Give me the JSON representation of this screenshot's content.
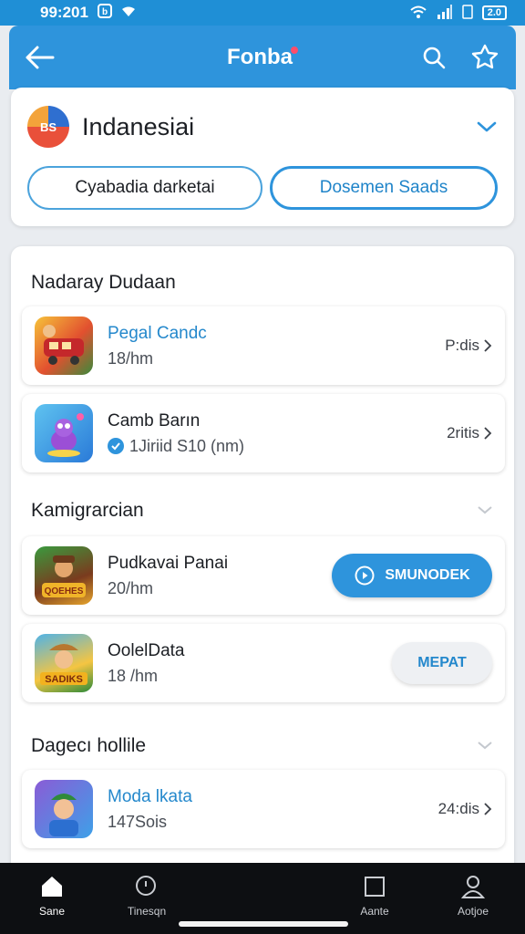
{
  "status_bar": {
    "time": "99:201",
    "battery": "2.0"
  },
  "app_bar": {
    "title": "Fonba"
  },
  "language": {
    "logo_text": "BS",
    "name": "Indanesiai"
  },
  "pills": {
    "left": "Cyabadia darketai",
    "right": "Dosemen Saads"
  },
  "sections": [
    {
      "title": "Nadaray Dudaan",
      "items": [
        {
          "name": "Pegal Candc",
          "sub": "18/hm",
          "meta": "P:dis"
        },
        {
          "name": "Camb Barın",
          "sub": "1Jiriid S10 (nm)",
          "meta": "2ritis"
        }
      ]
    },
    {
      "title": "Kamigrarcian",
      "items": [
        {
          "name": "Pudkavai Panai",
          "sub": "20/hm",
          "button": "SMUNODEK",
          "thumb_label": "QOEHES"
        },
        {
          "name": "OolelData",
          "sub": "18 /hm",
          "button": "MEPAT",
          "thumb_label": "SADIKS"
        }
      ]
    },
    {
      "title": "Dagecı hollile",
      "items": [
        {
          "name": "Moda lkata",
          "sub": "147Sois",
          "meta": "24:dis"
        }
      ]
    }
  ],
  "bottom_nav": [
    {
      "label": "Sane",
      "icon": "home-icon"
    },
    {
      "label": "Tinesqn",
      "icon": "search-icon"
    },
    {
      "label": "Aante",
      "icon": "square-icon"
    },
    {
      "label": "Aotjoe",
      "icon": "profile-icon"
    }
  ],
  "colors": {
    "primary": "#2e94dc",
    "background": "#e9ecf0",
    "nav_bg": "#0d0f12"
  }
}
